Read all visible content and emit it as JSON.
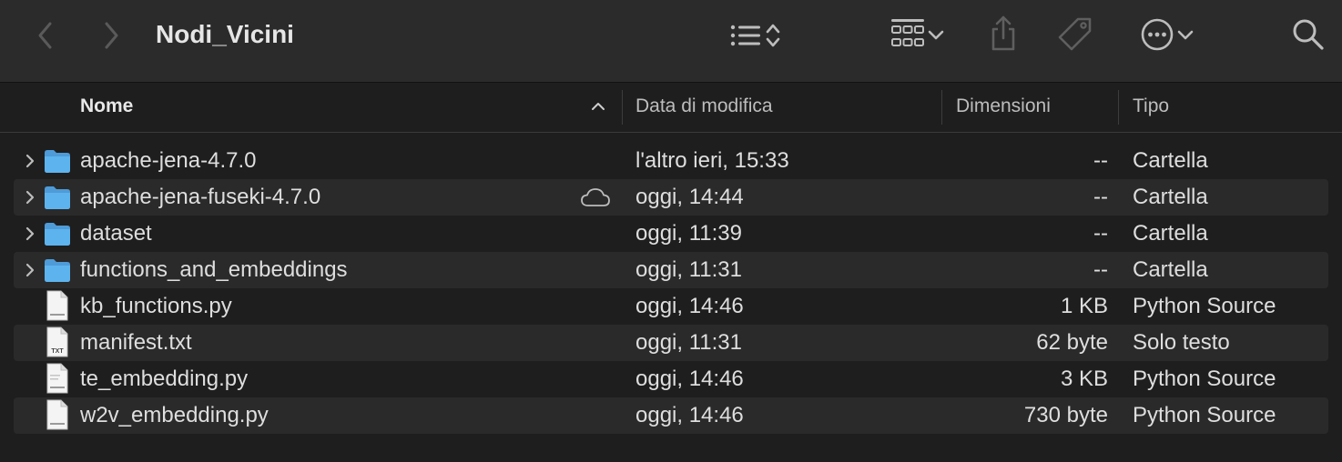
{
  "window": {
    "title": "Nodi_Vicini"
  },
  "toolbar": {
    "back_icon": "chevron-left-icon",
    "forward_icon": "chevron-right-icon",
    "view_icon": "list-view-icon",
    "group_icon": "grid-group-icon",
    "share_icon": "share-icon",
    "tag_icon": "tag-icon",
    "more_icon": "ellipsis-circle-icon",
    "search_icon": "search-icon"
  },
  "columns": {
    "name": "Nome",
    "date": "Data di modifica",
    "size": "Dimensioni",
    "kind": "Tipo"
  },
  "files": [
    {
      "name": "apache-jena-4.7.0",
      "date": "l'altro ieri, 15:33",
      "size": "--",
      "kind": "Cartella",
      "type": "folder"
    },
    {
      "name": "apache-jena-fuseki-4.7.0",
      "date": "oggi, 14:44",
      "size": "--",
      "kind": "Cartella",
      "type": "folder",
      "cloud": true
    },
    {
      "name": "dataset",
      "date": "oggi, 11:39",
      "size": "--",
      "kind": "Cartella",
      "type": "folder"
    },
    {
      "name": "functions_and_embeddings",
      "date": "oggi, 11:31",
      "size": "--",
      "kind": "Cartella",
      "type": "folder"
    },
    {
      "name": "kb_functions.py",
      "date": "oggi, 14:46",
      "size": "1 KB",
      "kind": "Python Source",
      "type": "python"
    },
    {
      "name": "manifest.txt",
      "date": "oggi, 11:31",
      "size": "62 byte",
      "kind": "Solo testo",
      "type": "text",
      "icon_label": "TXT"
    },
    {
      "name": "te_embedding.py",
      "date": "oggi, 14:46",
      "size": "3 KB",
      "kind": "Python Source",
      "type": "python"
    },
    {
      "name": "w2v_embedding.py",
      "date": "oggi, 14:46",
      "size": "730 byte",
      "kind": "Python Source",
      "type": "python"
    }
  ],
  "colors": {
    "folder": "#5aa9e6",
    "background": "#1e1e1e",
    "toolbar": "#2b2b2b",
    "alt_row": "#2a2a2a"
  }
}
